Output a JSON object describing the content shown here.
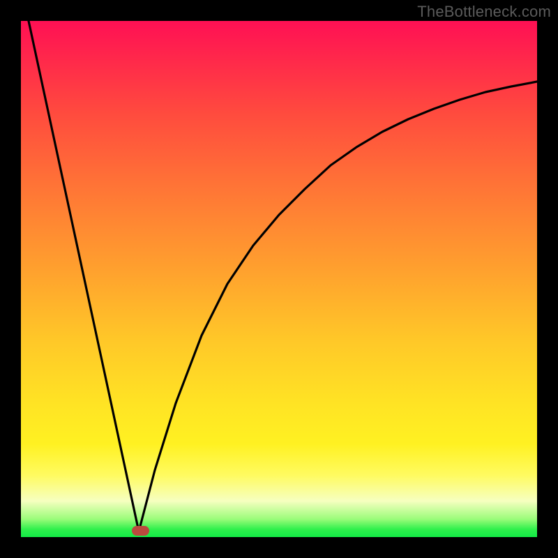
{
  "watermark": "TheBottleneck.com",
  "chart_data": {
    "type": "line",
    "title": "",
    "xlabel": "",
    "ylabel": "",
    "xlim": [
      0,
      1
    ],
    "ylim": [
      0,
      1
    ],
    "background": "heatmap-gradient red→orange→yellow→green (top to bottom)",
    "notes": "No numeric axes or tick labels are rendered. Curve is a V-shaped profile: steep linear drop from top-left to a minimum near x≈0.23, then a concave rise approaching ~0.88 at the right edge. A small rounded red marker sits at the trough.",
    "series": [
      {
        "name": "left-branch",
        "x": [
          0.015,
          0.228
        ],
        "values": [
          1.0,
          0.01
        ]
      },
      {
        "name": "right-branch",
        "x": [
          0.228,
          0.26,
          0.3,
          0.35,
          0.4,
          0.45,
          0.5,
          0.55,
          0.6,
          0.65,
          0.7,
          0.75,
          0.8,
          0.85,
          0.9,
          0.95,
          1.0
        ],
        "values": [
          0.01,
          0.13,
          0.26,
          0.39,
          0.49,
          0.565,
          0.625,
          0.675,
          0.72,
          0.755,
          0.785,
          0.81,
          0.83,
          0.848,
          0.862,
          0.873,
          0.882
        ]
      }
    ],
    "marker": {
      "x": 0.23,
      "y": 0.01,
      "color": "#bb4a3e"
    }
  }
}
